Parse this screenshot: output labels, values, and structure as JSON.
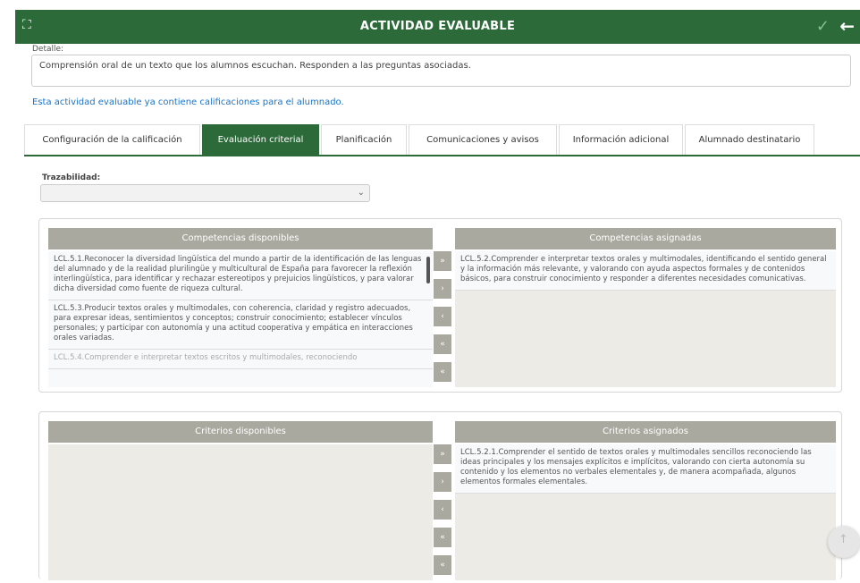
{
  "header": {
    "title": "ACTIVIDAD EVALUABLE",
    "expand_icon": "⛶",
    "check_icon": "✓",
    "back_icon": "←"
  },
  "detail": {
    "label": "Detalle:",
    "value": "Comprensión oral de un texto que los alumnos escuchan. Responden a las preguntas asociadas."
  },
  "notice": "Esta actividad evaluable ya contiene calificaciones para el alumnado.",
  "tabs": [
    {
      "label": "Configuración de la calificación"
    },
    {
      "label": "Evaluación criterial"
    },
    {
      "label": "Planificación"
    },
    {
      "label": "Comunicaciones y avisos"
    },
    {
      "label": "Información adicional"
    },
    {
      "label": "Alumnado destinatario"
    }
  ],
  "trazabilidad": {
    "label": "Trazabilidad:",
    "value": ""
  },
  "competencias": {
    "available_title": "Competencias disponibles",
    "assigned_title": "Competencias asignadas",
    "available": [
      "LCL.5.1.Reconocer la diversidad lingüística del mundo a partir de la identificación de las lenguas del alumnado y de la realidad plurilingüe y multicultural de España para favorecer la reflexión interlingüística, para identificar y rechazar estereotipos y prejuicios lingüísticos, y para valorar dicha diversidad como fuente de riqueza cultural.",
      "LCL.5.3.Producir textos orales y multimodales, con coherencia, claridad y registro adecuados, para expresar ideas, sentimientos y conceptos; construir conocimiento; establecer vínculos personales; y participar con autonomía y una actitud cooperativa y empática en interacciones orales variadas.",
      "LCL.5.4.Comprender e interpretar textos escritos y multimodales, reconociendo"
    ],
    "assigned": [
      "LCL.5.2.Comprender e interpretar textos orales y multimodales, identificando el sentido general y la información más relevante, y valorando con ayuda aspectos formales y de contenidos básicos, para construir conocimiento y responder a diferentes necesidades comunicativas."
    ],
    "buttons": [
      "»",
      "›",
      "‹",
      "«",
      "«"
    ]
  },
  "criterios": {
    "available_title": "Criterios disponibles",
    "assigned_title": "Criterios asignados",
    "assigned": [
      "LCL.5.2.1.Comprender el sentido de textos orales y multimodales sencillos reconociendo las ideas principales y los mensajes explícitos e implícitos, valorando con cierta autonomía su contenido y los elementos no verbales elementales y, de manera acompañada, algunos elementos formales elementales."
    ],
    "buttons": [
      "»",
      "›",
      "‹",
      "«",
      "«"
    ]
  },
  "fab_icon": "↑"
}
